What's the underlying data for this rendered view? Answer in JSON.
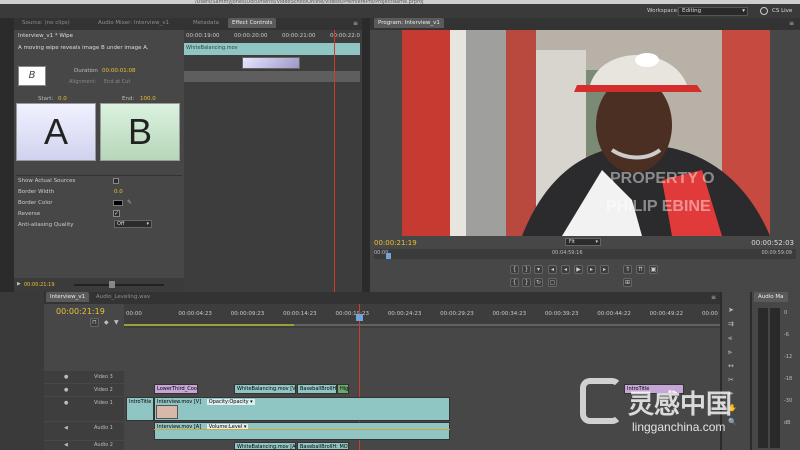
{
  "title_path": "/Users/SammyJones/Documents/VideoSchoolOnline/Videos/PremierePro/ProjectName.prproj",
  "workspace": {
    "label": "Workspace:",
    "value": "Editing",
    "cs_live": "CS Live"
  },
  "source_tabs": [
    "Source: (no clips)",
    "Audio Mixer: Interview_v1",
    "Metadata",
    "Effect Controls"
  ],
  "effect_controls": {
    "breadcrumb": "Interview_v1 * Wipe",
    "description": "A moving wipe reveals image B under image A.",
    "duration_label": "Duration",
    "duration_value": "00:00:01:08",
    "alignment_label": "Alignment:",
    "alignment_value": "End at Cut",
    "start_label": "Start:",
    "start_value": "0.0",
    "end_label": "End:",
    "end_value": "100.0",
    "thumb_a": "A",
    "thumb_b": "B",
    "thumb_icon": "B",
    "times": [
      "00:00:19:00",
      "00:00:20:00",
      "00:00:21:00",
      "00:00:22:0"
    ],
    "clip_label": "WhiteBalancing.mov",
    "properties": [
      {
        "label": "Show Actual Sources",
        "value": ""
      },
      {
        "label": "Border Width",
        "value": "0.0"
      },
      {
        "label": "Border Color",
        "value": ""
      },
      {
        "label": "Reverse",
        "value": "✓"
      },
      {
        "label": "Anti-aliasing Quality",
        "value": "Off"
      }
    ],
    "footer_time": "00:00:21:19"
  },
  "program": {
    "tab": "Program: Interview_v1",
    "watermark_line1": "PROPERTY O",
    "watermark_line2": "PHILIP EBINE",
    "current_time": "00:00:21:19",
    "fit": "Fit",
    "duration": "00:00:52:03",
    "ruler_start": "00:00",
    "ruler_mid": "00:04:59:16",
    "ruler_end": "00:09:59:09"
  },
  "timeline": {
    "tabs": [
      "Interview_v1",
      "Audio_Leveling.wav"
    ],
    "current_time": "00:00:21:19",
    "ticks": [
      "00:00",
      "00:00:04:23",
      "00:00:09:23",
      "00:00:14:23",
      "00:00:19:23",
      "00:00:24:23",
      "00:00:29:23",
      "00:00:34:23",
      "00:00:39:23",
      "00:00:44:22",
      "00:00:49:22",
      "00:00"
    ],
    "tracks": {
      "video3": "Video 3",
      "video2": "Video 2",
      "video1": "Video 1",
      "audio1": "Audio 1",
      "audio2": "Audio 2"
    },
    "clips": {
      "lowerthird": "LowerThird_Coo",
      "wb_v2": "WhiteBalancing.mov [V",
      "baseball_v2": "BaseballBrollH",
      "green": "High",
      "intro_title": "IntroTitle",
      "interview_v": "Interview.mov [V]",
      "opacity": "Opacity:Opacity ▾",
      "intro_title2": "IntroTitle",
      "interview_a": "Interview.mov [A]",
      "volume": "Volume:Level ▾",
      "wb_a2": "WhiteBalancing.mov [A",
      "baseball_a2": "BaseballBrollH: MOV"
    }
  },
  "audio_master": {
    "tab": "Audio Ma",
    "scale": [
      "0",
      "-6",
      "-12",
      "-18",
      "-30",
      "dB"
    ]
  },
  "watermark": {
    "cn": "灵感中国",
    "url": "lingganchina.com"
  },
  "colors": {
    "timecode": "#e7c233",
    "playhead": "#d23a2a",
    "clip_video": "#8fc6c3",
    "clip_purple": "#c6a6d6"
  }
}
